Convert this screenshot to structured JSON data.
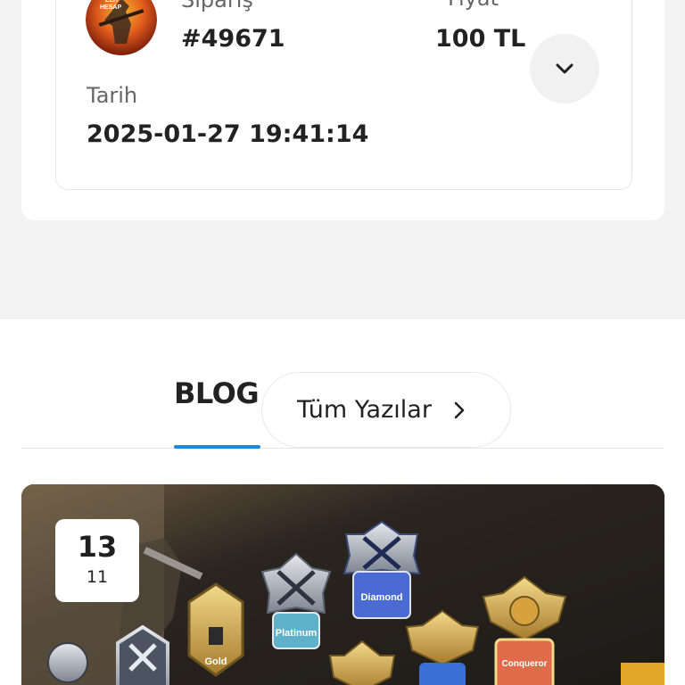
{
  "order": {
    "order_label": "Sipariş",
    "order_number": "#49671",
    "price_label": "Fiyat",
    "price_value": "100 TL",
    "date_label": "Tarih",
    "date_value": "2025-01-27 19:41:14",
    "avatar_text": "ELIT HESAP",
    "expand_icon": "chevron-down-icon"
  },
  "blog": {
    "title": "BLOG",
    "all_posts_label": "Tüm Yazılar",
    "all_posts_icon": "chevron-right-icon",
    "post": {
      "day": "13",
      "month": "11",
      "rank_labels": [
        "Gold",
        "Platinum",
        "Diamond",
        "Conqueror"
      ]
    }
  },
  "colors": {
    "accent": "#1e88d6",
    "page_bg": "#f3f3f3",
    "card_border": "#e6e6e6"
  }
}
